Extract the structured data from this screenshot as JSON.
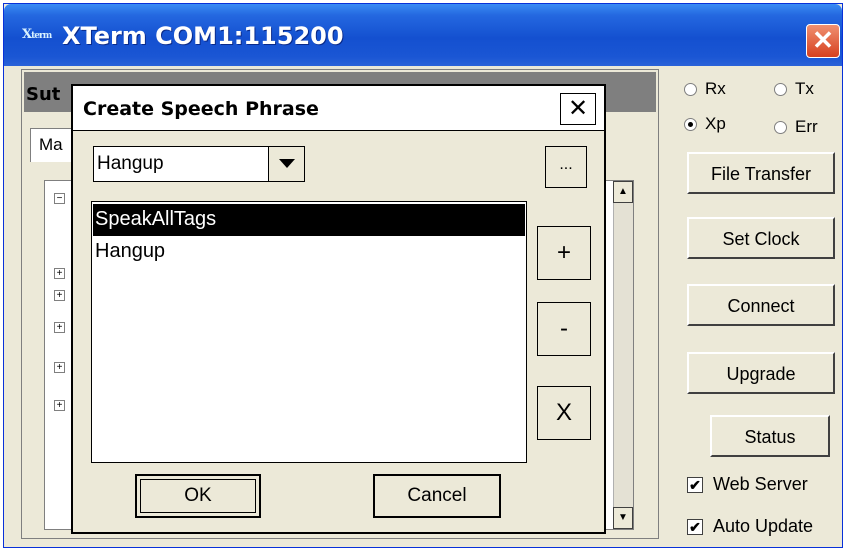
{
  "window": {
    "title": "XTerm COM1:115200",
    "icon": "xterm-icon",
    "close_label": "✕"
  },
  "background": {
    "header_text": "Sut",
    "tab_label": "Ma",
    "tree_minus": "−",
    "tree_plus": "+"
  },
  "radios": [
    {
      "label": "Rx",
      "checked": false
    },
    {
      "label": "Tx",
      "checked": false
    },
    {
      "label": "Xp",
      "checked": true
    },
    {
      "label": "Err",
      "checked": false
    }
  ],
  "side_buttons": [
    "File Transfer",
    "Set Clock",
    "Connect",
    "Upgrade",
    "Status"
  ],
  "checkboxes": [
    {
      "label": "Web Server",
      "checked": true
    },
    {
      "label": "Auto Update",
      "checked": true
    }
  ],
  "dialog": {
    "title": "Create Speech Phrase",
    "close_label": "✕",
    "combo_value": "Hangup",
    "dots_label": "...",
    "list_items": [
      {
        "text": "SpeakAllTags",
        "selected": true
      },
      {
        "text": "Hangup",
        "selected": false
      }
    ],
    "add_label": "+",
    "remove_label": "-",
    "clear_label": "X",
    "ok_label": "OK",
    "cancel_label": "Cancel"
  },
  "colors": {
    "title_bar": "#1450d0",
    "close_button": "#d6401f",
    "dialog_bg": "#ece9d8",
    "selection": "#000000"
  }
}
